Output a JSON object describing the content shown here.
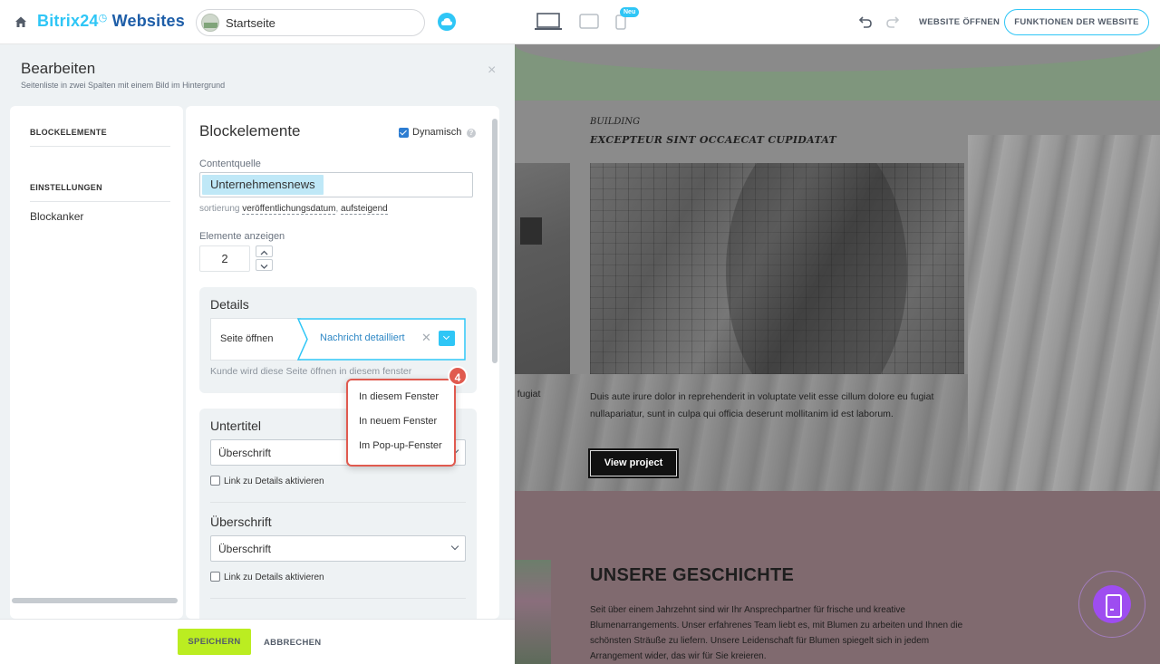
{
  "topbar": {
    "logo_part1": "Bitrix24",
    "logo_part2": "Websites",
    "page_name": "Startseite",
    "new_badge": "Neu",
    "open_website": "WEBSITE ÖFFNEN",
    "site_functions": "FUNKTIONEN DER WEBSITE"
  },
  "panel": {
    "title": "Bearbeiten",
    "subtitle": "Seitenliste in zwei Spalten mit einem Bild im Hintergrund",
    "close": "×",
    "nav": {
      "block_elements": "BLOCKELEMENTE",
      "settings": "EINSTELLUNGEN",
      "anchor": "Blockanker"
    },
    "content": {
      "title": "Blockelemente",
      "dynamic_label": "Dynamisch",
      "help": "?",
      "source_label": "Contentquelle",
      "source_value": "Unternehmensnews",
      "sort_prefix": "sortierung",
      "sort_field": "veröffentlichungsdatum",
      "sort_dir": "aufsteigend",
      "count_label": "Elemente anzeigen",
      "count_value": "2",
      "details": {
        "title": "Details",
        "open_label": "Seite öffnen",
        "open_value": "Nachricht detailliert",
        "hint": "Kunde wird diese Seite öffnen in diesem fenster"
      },
      "subtitle_card": {
        "title": "Untertitel",
        "select_value": "Überschrift",
        "checkbox_label": "Link zu Details aktivieren",
        "heading_title": "Überschrift",
        "heading_select": "Überschrift",
        "heading_checkbox_label": "Link zu Details aktivieren"
      }
    },
    "popup": {
      "items": [
        "In diesem Fenster",
        "In neuem Fenster",
        "Im Pop-up-Fenster"
      ],
      "step_badge": "4"
    },
    "footer": {
      "save": "SPEICHERN",
      "cancel": "ABBRECHEN"
    }
  },
  "preview": {
    "small_title": "BUILDING",
    "heading": "EXCEPTEUR SINT OCCAECAT CUPIDATAT",
    "paragraph": "Duis aute irure dolor in reprehenderit in voluptate velit esse cillum dolore eu fugiat nullapariatur, sunt in culpa qui officia deserunt mollitanim id est laborum.",
    "paragraph_left": "u fugiat",
    "button": "View project",
    "section_title": "UNSERE GESCHICHTE",
    "section_text": "Seit über einem Jahrzehnt sind wir Ihr Ansprechpartner für frische und kreative Blumenarrangements. Unser erfahrenes Team liebt es, mit Blumen zu arbeiten und Ihnen die schönsten Sträuße zu liefern. Unsere Leidenschaft für Blumen spiegelt sich in jedem Arrangement wider, das wir für Sie kreieren."
  }
}
